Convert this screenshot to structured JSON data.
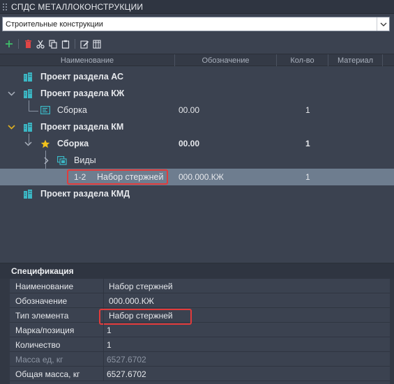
{
  "window": {
    "title": "СПДС МЕТАЛЛОКОНСТРУКЦИИ"
  },
  "combo": {
    "value": "Строительные конструкции"
  },
  "toolbar": {
    "items": [
      "add-icon",
      "delete-icon",
      "cut-icon",
      "copy-icon",
      "paste-icon",
      "edit-icon",
      "table-icon"
    ]
  },
  "columns": {
    "name": "Наименование",
    "designation": "Обозначение",
    "qty": "Кол-во",
    "material": "Материал"
  },
  "tree": {
    "r1": {
      "name": "Проект раздела АС"
    },
    "r2": {
      "name": "Проект раздела КЖ"
    },
    "r3": {
      "name": "Сборка",
      "designation": "00.00",
      "qty": "1"
    },
    "r4": {
      "name": "Проект раздела КМ"
    },
    "r5": {
      "name": "Сборка",
      "designation": "00.00",
      "qty": "1"
    },
    "r6": {
      "name": "Виды"
    },
    "r7": {
      "mark": "1-2",
      "name": "Набор стержней",
      "designation": "000.000.КЖ",
      "qty": "1"
    },
    "r8": {
      "name": "Проект раздела КМД"
    }
  },
  "spec": {
    "title": "Спецификация",
    "props": [
      {
        "label": "Наименование",
        "value": "Набор стержней"
      },
      {
        "label": "Обозначение",
        "value": "000.000.КЖ"
      },
      {
        "label": "Тип элемента",
        "value": "Набор стержней"
      },
      {
        "label": "Марка/позиция",
        "value": "1"
      },
      {
        "label": "Количество",
        "value": "1"
      },
      {
        "label": "Масса ед, кг",
        "value": "6527.6702"
      },
      {
        "label": "Общая масса, кг",
        "value": "6527.6702"
      }
    ]
  },
  "colors": {
    "background": "#3b4250",
    "selection": "#6e7d8f",
    "highlight": "#e23b3b",
    "building_icon": "#3bb7c4",
    "star": "#f2c21b",
    "chevron_open": "#e0b020"
  }
}
